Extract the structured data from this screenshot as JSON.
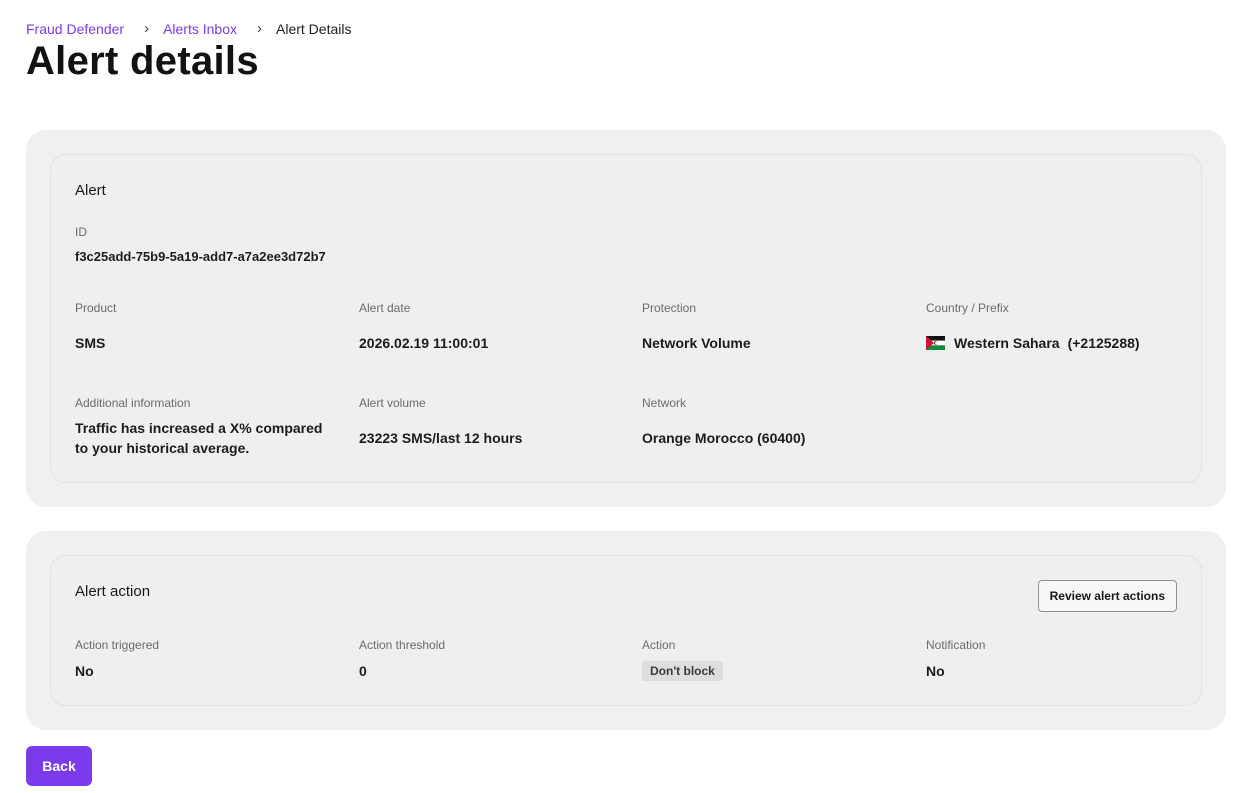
{
  "breadcrumb": {
    "items": [
      {
        "label": "Fraud Defender"
      },
      {
        "label": "Alerts Inbox"
      },
      {
        "label": "Alert Details"
      }
    ]
  },
  "page_title": "Alert details",
  "alert": {
    "section_title": "Alert",
    "id_label": "ID",
    "id_value": "f3c25add-75b9-5a19-add7-a7a2ee3d72b7",
    "product_label": "Product",
    "product_value": "SMS",
    "date_label": "Alert date",
    "date_value": "2026.02.19 11:00:01",
    "protection_label": "Protection",
    "protection_value": "Network Volume",
    "country_label": "Country / Prefix",
    "country_value": "Western Sahara",
    "prefix_value": "(+2125288)",
    "country_flag_icon": "western-sahara-flag-icon",
    "info_label": "Additional information",
    "info_value": "Traffic has increased a X% compared to your historical average.",
    "volume_label": "Alert volume",
    "volume_value": "23223 SMS/last 12 hours",
    "network_label": "Network",
    "network_value": "Orange Morocco (60400)"
  },
  "alert_action": {
    "section_title": "Alert action",
    "review_button": "Review alert actions",
    "triggered_label": "Action triggered",
    "triggered_value": "No",
    "threshold_label": "Action threshold",
    "threshold_value": "0",
    "action_label": "Action",
    "action_value": "Don't block",
    "notification_label": "Notification",
    "notification_value": "No"
  },
  "back_button": "Back",
  "colors": {
    "accent": "#7c3aed",
    "panel_bg": "#f0f0f0"
  }
}
